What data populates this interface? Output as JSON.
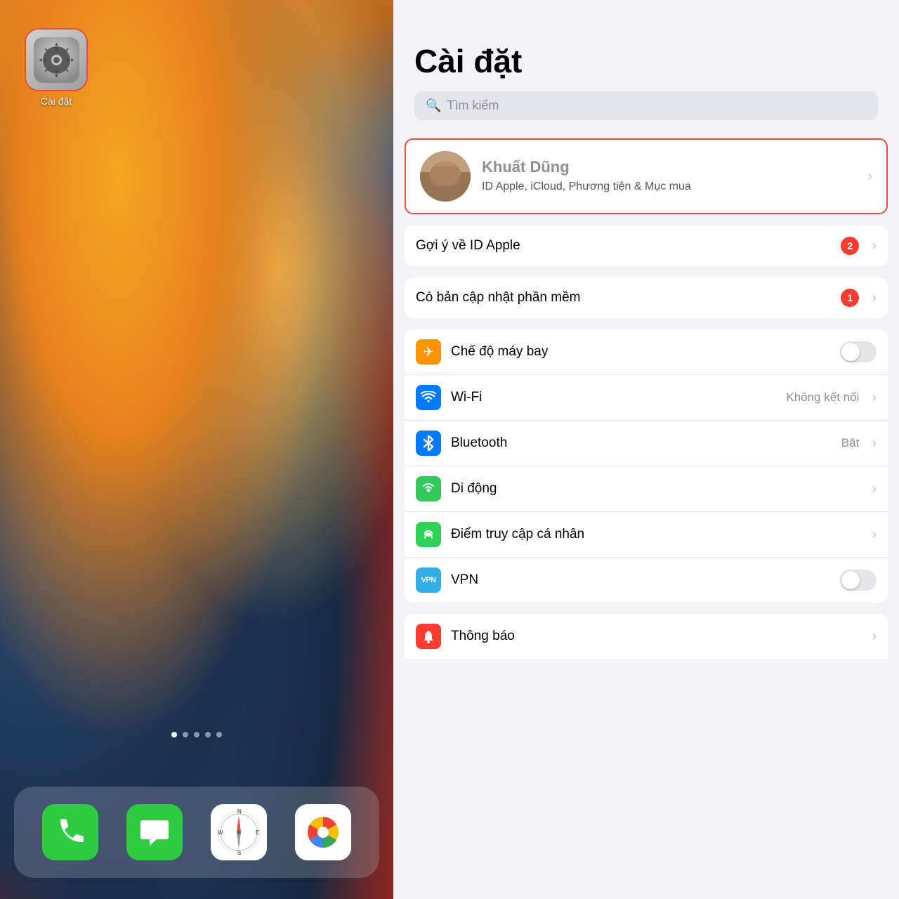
{
  "left": {
    "settings_app": {
      "label": "Cài đặt"
    },
    "dock": {
      "phone_label": "Phone",
      "messages_label": "Messages",
      "safari_label": "Safari",
      "photos_label": "Photos"
    },
    "dots": [
      1,
      2,
      3,
      4,
      5
    ]
  },
  "right": {
    "title": "Cài đặt",
    "search_placeholder": "Tìm kiếm",
    "profile": {
      "name": "Khuất Dũng",
      "subtitle": "ID Apple, iCloud, Phương tiện &\nMục mua"
    },
    "apple_id_suggestion": {
      "label": "Gợi ý về ID Apple",
      "badge": "2"
    },
    "software_update": {
      "label": "Có bản cập nhật phần mềm",
      "badge": "1"
    },
    "settings_items": [
      {
        "id": "airplane",
        "label": "Chế độ máy bay",
        "icon_color": "orange",
        "icon_symbol": "✈",
        "type": "toggle",
        "value": ""
      },
      {
        "id": "wifi",
        "label": "Wi-Fi",
        "icon_color": "blue",
        "icon_symbol": "wifi",
        "type": "value_chevron",
        "value": "Không kết nối"
      },
      {
        "id": "bluetooth",
        "label": "Bluetooth",
        "icon_color": "blue",
        "icon_symbol": "bt",
        "type": "value_chevron",
        "value": "Bật"
      },
      {
        "id": "mobile",
        "label": "Di động",
        "icon_color": "green",
        "icon_symbol": "signal",
        "type": "chevron",
        "value": ""
      },
      {
        "id": "hotspot",
        "label": "Điểm truy cập cá nhân",
        "icon_color": "green2",
        "icon_symbol": "link",
        "type": "chevron",
        "value": ""
      },
      {
        "id": "vpn",
        "label": "VPN",
        "icon_color": "blue2",
        "icon_symbol": "VPN",
        "type": "toggle",
        "value": ""
      }
    ],
    "bottom_item": {
      "label": "Thông báo",
      "icon_color": "red"
    }
  }
}
